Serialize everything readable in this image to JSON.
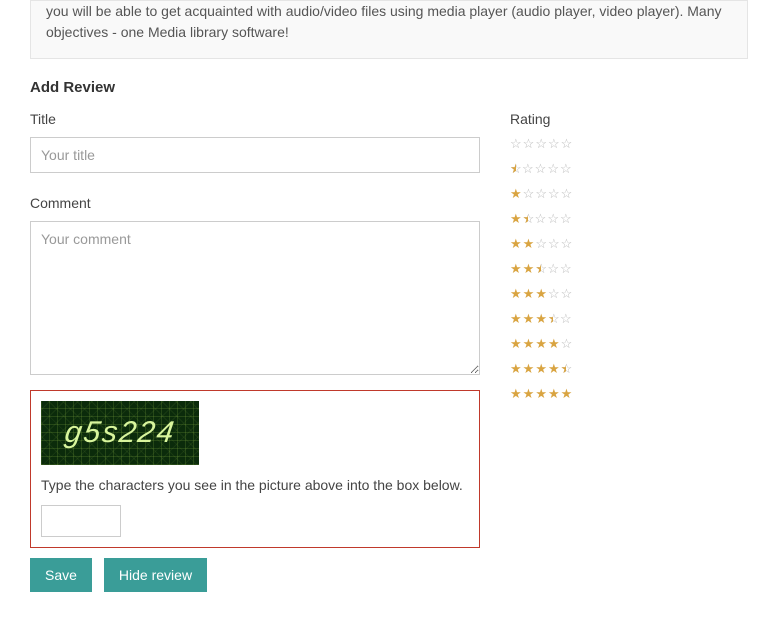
{
  "description": {
    "text": "you will be able to get acquainted with audio/video files using media player (audio player, video player). Many objectives - one Media library software!"
  },
  "review": {
    "heading": "Add Review",
    "title_label": "Title",
    "title_placeholder": "Your title",
    "comment_label": "Comment",
    "comment_placeholder": "Your comment",
    "rating_label": "Rating"
  },
  "captcha": {
    "display_text": "g5s224",
    "instruction": "Type the characters you see in the picture above into the box below."
  },
  "buttons": {
    "save": "Save",
    "hide": "Hide review"
  },
  "ratings": [
    {
      "value": 0.0
    },
    {
      "value": 0.5
    },
    {
      "value": 1.0
    },
    {
      "value": 1.5
    },
    {
      "value": 2.0
    },
    {
      "value": 2.5
    },
    {
      "value": 3.0
    },
    {
      "value": 3.5
    },
    {
      "value": 4.0
    },
    {
      "value": 4.5
    },
    {
      "value": 5.0
    }
  ]
}
